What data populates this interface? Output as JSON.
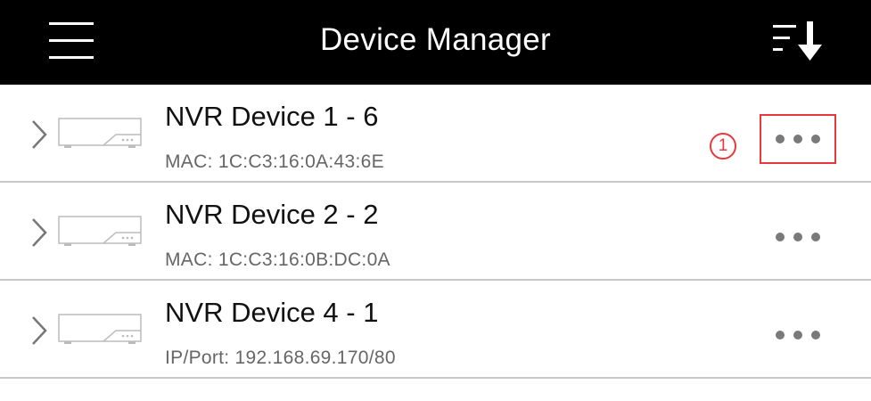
{
  "header": {
    "title": "Device Manager",
    "menu_icon": "hamburger-menu-icon",
    "sort_icon": "sort-down-icon",
    "background_color": "#000000",
    "text_color": "#ffffff"
  },
  "devices": [
    {
      "name": "NVR Device 1 - 6",
      "info": "MAC: 1C:C3:16:0A:43:6E",
      "more_icon": "more-dots-icon",
      "highlighted": true,
      "step_badge": "1"
    },
    {
      "name": "NVR Device 2 - 2",
      "info": "MAC: 1C:C3:16:0B:DC:0A",
      "more_icon": "more-dots-icon",
      "highlighted": false
    },
    {
      "name": "NVR Device 4 - 1",
      "info": "IP/Port: 192.168.69.170/80",
      "more_icon": "more-dots-icon",
      "highlighted": false
    }
  ],
  "colors": {
    "highlight": "#e8383d",
    "divider": "#c8c8c8",
    "secondary_text": "#666666"
  }
}
